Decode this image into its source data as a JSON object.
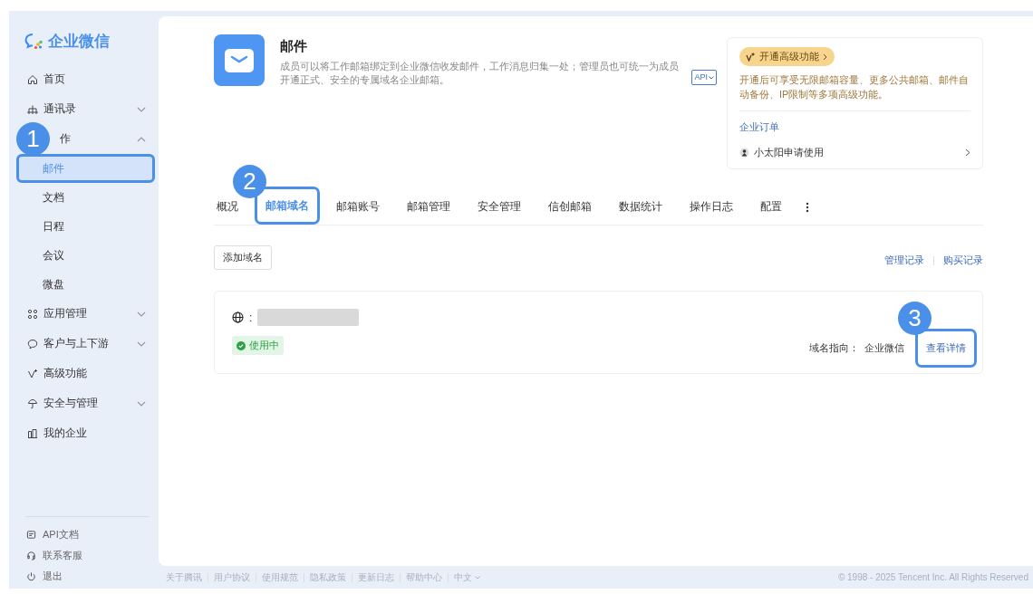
{
  "logo": {
    "text": "企业微信"
  },
  "sidebar": {
    "items": [
      {
        "label": "首页"
      },
      {
        "label": "通讯录",
        "expanded": false
      },
      {
        "label": "作",
        "expanded": true,
        "children": [
          {
            "label": "邮件",
            "selected": true,
            "callout": "1"
          },
          {
            "label": "文档",
            "selected": false
          },
          {
            "label": "日程",
            "selected": false
          },
          {
            "label": "会议",
            "selected": false
          },
          {
            "label": "微盘",
            "selected": false
          }
        ]
      },
      {
        "label": "应用管理",
        "expanded": false
      },
      {
        "label": "客户与上下游",
        "expanded": false
      },
      {
        "label": "高级功能"
      },
      {
        "label": "安全与管理",
        "expanded": false
      },
      {
        "label": "我的企业"
      }
    ],
    "bottom_links": [
      "API文档",
      "联系客服",
      "退出"
    ]
  },
  "header": {
    "title": "邮件",
    "description": "成员可以将工作邮箱绑定到企业微信收发邮件，工作消息归集一处；管理员也可统一为成员开通正式、安全的专属域名企业邮箱。",
    "api_tag": "API"
  },
  "promo": {
    "button": "开通高级功能",
    "text": "开通后可享受无限邮箱容量、更多公共邮箱、邮件自动备份、IP限制等多项高级功能。",
    "orders_title": "企业订单",
    "order_item": "小太阳申请使用"
  },
  "tabs": [
    {
      "label": "概况",
      "selected": false
    },
    {
      "label": "邮箱域名",
      "selected": true,
      "callout": "2"
    },
    {
      "label": "邮箱账号",
      "selected": false
    },
    {
      "label": "邮箱管理",
      "selected": false
    },
    {
      "label": "安全管理",
      "selected": false
    },
    {
      "label": "信创邮箱",
      "selected": false
    },
    {
      "label": "数据统计",
      "selected": false
    },
    {
      "label": "操作日志",
      "selected": false
    },
    {
      "label": "配置",
      "selected": false
    }
  ],
  "toolbar": {
    "add_button": "添加域名",
    "links": [
      "管理记录",
      "购买记录"
    ]
  },
  "domain": {
    "separator": ":",
    "status": "使用中",
    "target_label": "域名指向：",
    "target_value": "企业微信",
    "details_link": {
      "label": "查看详情",
      "callout": "3"
    }
  },
  "footer": {
    "links": [
      "关于腾讯",
      "用户协议",
      "使用规范",
      "隐私政策",
      "更新日志",
      "帮助中心"
    ],
    "language": "中文",
    "copyright": "© 1998 - 2025 Tencent Inc. All Rights Reserved"
  }
}
